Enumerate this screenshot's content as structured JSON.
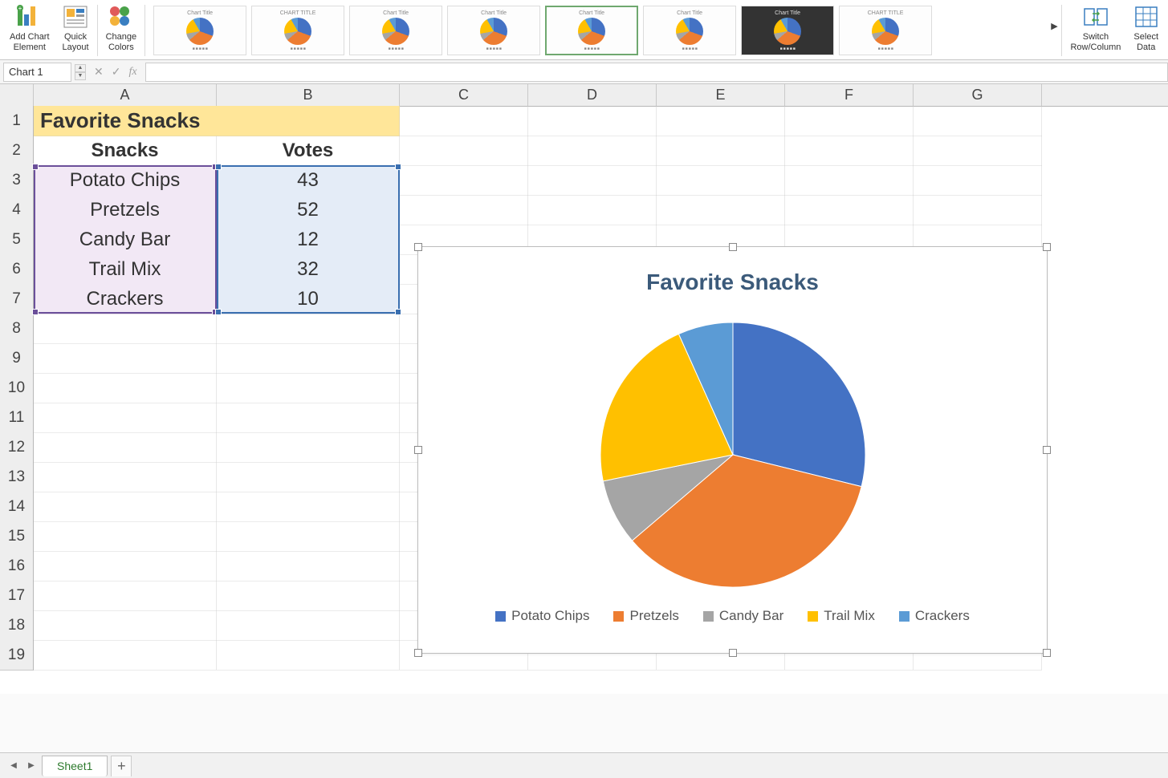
{
  "ribbon": {
    "add_chart_element": "Add Chart\nElement",
    "quick_layout": "Quick\nLayout",
    "change_colors": "Change\nColors",
    "switch_row_col": "Switch\nRow/Column",
    "select_data": "Select\nData",
    "style_thumbs": [
      {
        "title": "Chart Title",
        "selected": false,
        "dark": false
      },
      {
        "title": "CHART TITLE",
        "selected": false,
        "dark": false
      },
      {
        "title": "Chart Title",
        "selected": false,
        "dark": false
      },
      {
        "title": "Chart Title",
        "selected": false,
        "dark": false
      },
      {
        "title": "Chart Title",
        "selected": true,
        "dark": false
      },
      {
        "title": "Chart Title",
        "selected": false,
        "dark": false
      },
      {
        "title": "Chart Title",
        "selected": false,
        "dark": true
      },
      {
        "title": "CHART TITLE",
        "selected": false,
        "dark": false
      }
    ]
  },
  "formula_bar": {
    "name_box": "Chart 1",
    "formula": ""
  },
  "columns": [
    "A",
    "B",
    "C",
    "D",
    "E",
    "F",
    "G"
  ],
  "rows_visible": 19,
  "table": {
    "title": "Favorite Snacks",
    "header": [
      "Snacks",
      "Votes"
    ],
    "rows": [
      [
        "Potato Chips",
        43
      ],
      [
        "Pretzels",
        52
      ],
      [
        "Candy Bar",
        12
      ],
      [
        "Trail Mix",
        32
      ],
      [
        "Crackers",
        10
      ]
    ]
  },
  "chart": {
    "title": "Favorite Snacks",
    "legend": [
      "Potato Chips",
      "Pretzels",
      "Candy Bar",
      "Trail Mix",
      "Crackers"
    ]
  },
  "chart_data": {
    "type": "pie",
    "title": "Favorite Snacks",
    "categories": [
      "Potato Chips",
      "Pretzels",
      "Candy Bar",
      "Trail Mix",
      "Crackers"
    ],
    "values": [
      43,
      52,
      12,
      32,
      10
    ],
    "colors": [
      "#4472c4",
      "#ed7d31",
      "#a5a5a5",
      "#ffc000",
      "#5b9bd5"
    ]
  },
  "sheet_tabs": {
    "active": "Sheet1"
  }
}
